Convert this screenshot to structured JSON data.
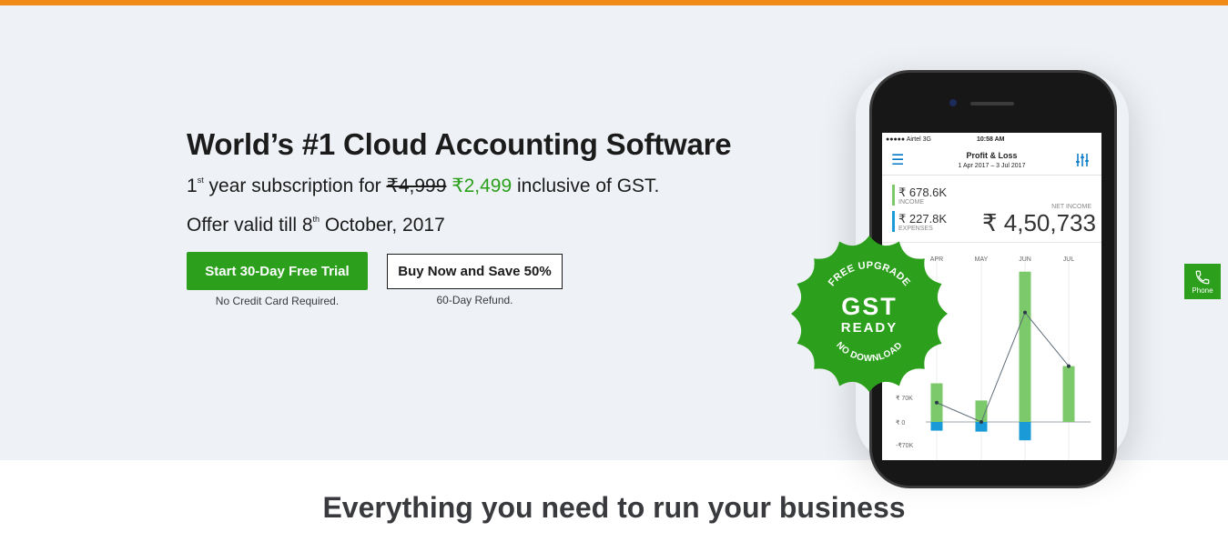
{
  "hero": {
    "headline": "World’s #1 Cloud Accounting Software",
    "sub_prefix": "1",
    "sub_sup": "st",
    "sub_mid": " year subscription for ",
    "old_price": "₹4,999",
    "new_price": "₹2,499",
    "sub_suffix": " inclusive of GST.",
    "offer_prefix": "Offer valid till 8",
    "offer_sup": "th",
    "offer_suffix": " October, 2017",
    "primary_button": "Start 30-Day Free Trial",
    "primary_note": "No Credit Card Required.",
    "secondary_button": "Buy Now and Save 50%",
    "secondary_note": "60-Day Refund."
  },
  "phone_screen": {
    "carrier": "●●●●● Airtel  3G",
    "time": "10:58 AM",
    "title": "Profit & Loss",
    "date_range": "1 Apr 2017 – 3 Jul 2017",
    "income_value": "₹ 678.6K",
    "income_label": "INCOME",
    "expenses_value": "₹ 227.8K",
    "expenses_label": "EXPENSES",
    "net_label": "NET INCOME",
    "net_value": "₹ 4,50,733",
    "menu_icon": "hamburger-icon",
    "filter_icon": "filter-icon"
  },
  "badge": {
    "top_text": "FREE UPGRADE",
    "main": "GST",
    "sub": "READY",
    "bottom_text": "NO DOWNLOAD"
  },
  "side_widget": {
    "label": "Phone",
    "icon": "phone-icon"
  },
  "section": {
    "title": "Everything you need to run your business"
  },
  "colors": {
    "accent_orange": "#f08a19",
    "brand_green": "#2ca01c",
    "income_green": "#7cc96b",
    "expense_blue": "#1a9bd7"
  },
  "chart_data": {
    "type": "bar",
    "categories": [
      "APR",
      "MAY",
      "JUN",
      "JUL"
    ],
    "y_tick_labels": [
      "₹ 70K",
      "₹ 0",
      "-₹70K"
    ],
    "series": [
      {
        "values": [
          90,
          50,
          350,
          130
        ]
      },
      {
        "values": [
          -45,
          -50,
          -95,
          0
        ]
      }
    ],
    "line": [
      45,
      0,
      255,
      130
    ],
    "ylim": [
      -95,
      360
    ]
  }
}
